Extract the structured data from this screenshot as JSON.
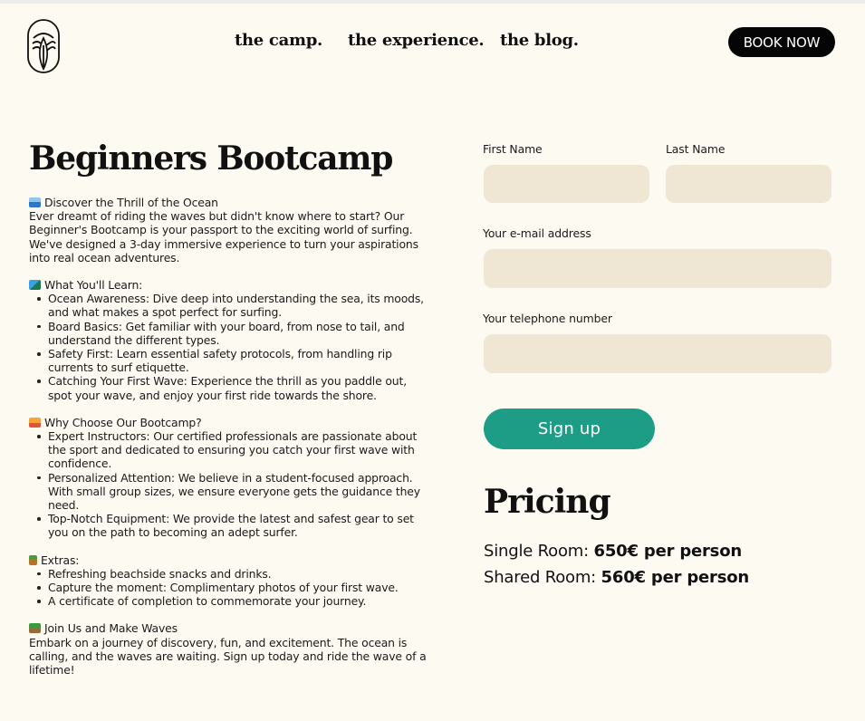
{
  "nav": {
    "items": [
      "the camp.",
      "the experience.",
      "the blog."
    ],
    "book_label": "BOOK NOW"
  },
  "main": {
    "title": "Beginners Bootcamp",
    "intro": {
      "heading": "Discover the Thrill of the Ocean",
      "body": "Ever dreamt of riding the waves but didn't know where to start? Our Beginner's Bootcamp is your passport to the exciting world of surfing. We've designed a 3-day immersive experience to turn your aspirations into real ocean adventures."
    },
    "learn": {
      "heading": "What You'll Learn:",
      "items": [
        "Ocean Awareness: Dive deep into understanding the sea, its moods, and what makes a spot perfect for surfing.",
        "Board Basics: Get familiar with your board, from nose to tail, and understand the different types.",
        "Safety First: Learn essential safety protocols, from handling rip currents to surf etiquette.",
        "Catching Your First Wave: Experience the thrill as you paddle out, spot your wave, and enjoy your first ride towards the shore."
      ]
    },
    "why": {
      "heading": "Why Choose Our Bootcamp?",
      "items": [
        "Expert Instructors: Our certified professionals are passionate about the sport and dedicated to ensuring you catch your first wave with confidence.",
        "Personalized Attention: We believe in a student-focused approach. With small group sizes, we ensure everyone gets the guidance they need.",
        "Top-Notch Equipment: We provide the latest and safest gear to set you on the path to becoming an adept surfer."
      ]
    },
    "extras": {
      "heading": "Extras:",
      "items": [
        "Refreshing beachside snacks and drinks.",
        "Capture the moment: Complimentary photos of your first wave.",
        "A certificate of completion to commemorate your journey."
      ]
    },
    "join": {
      "heading": "Join Us and Make Waves",
      "body": "Embark on a journey of discovery, fun, and excitement. The ocean is calling, and the waves are waiting. Sign up today and ride the wave of a lifetime!"
    }
  },
  "form": {
    "first_name_label": "First Name",
    "first_name_value": "",
    "last_name_label": "Last Name",
    "last_name_value": "",
    "email_label": "Your e-mail address",
    "email_value": "",
    "phone_label": "Your telephone number",
    "phone_value": "",
    "submit_label": "Sign up"
  },
  "pricing": {
    "title": "Pricing",
    "rows": [
      {
        "label": "Single Room:",
        "price": "650€ per person"
      },
      {
        "label": "Shared Room:",
        "price": "560€ per person"
      }
    ]
  },
  "colors": {
    "background": "#fdfaf2",
    "input_fill": "#efe6d4",
    "accent_teal": "#1d9d86",
    "book_button": "#050505"
  },
  "icons": [
    "surf-logo-icon",
    "wave-emoji-icon",
    "surfer-emoji-icon",
    "sunset-emoji-icon",
    "drink-emoji-icon",
    "palm-tree-emoji-icon"
  ]
}
